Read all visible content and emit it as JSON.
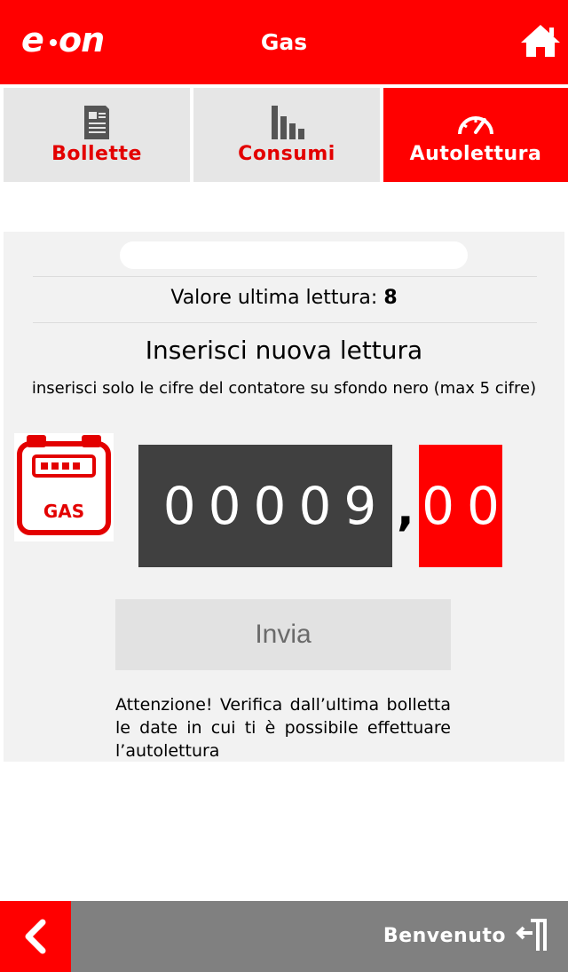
{
  "header": {
    "logo_text": "e·on",
    "title": "Gas",
    "home_icon": "home-icon"
  },
  "tabs": [
    {
      "label": "Bollette",
      "icon": "bill-icon",
      "active": false
    },
    {
      "label": "Consumi",
      "icon": "bar-chart-icon",
      "active": false
    },
    {
      "label": "Autolettura",
      "icon": "gauge-icon",
      "active": true
    }
  ],
  "main": {
    "last_reading_label": "Valore ultima lettura:",
    "last_reading_value": "8",
    "section_title": "Inserisci nuova lettura",
    "hint": "inserisci solo le cifre del contatore su sfondo nero (max 5 cifre)",
    "meter_label": "GAS",
    "digits_integer": [
      "0",
      "0",
      "0",
      "0",
      "9"
    ],
    "decimal_separator": ",",
    "digits_decimal": [
      "0",
      "0"
    ],
    "send_label": "Invia",
    "warning": "Attenzione! Verifica dall’ultima bolletta le date in cui ti è possibile effettuare l’autolettura"
  },
  "footer": {
    "welcome": "Benvenuto",
    "back_icon": "chevron-left-icon",
    "logout_icon": "logout-icon"
  },
  "colors": {
    "brand_red": "#ff0000",
    "tab_bg": "#e6e6e6",
    "digit_bg": "#404040",
    "footer_gray": "#808080"
  }
}
